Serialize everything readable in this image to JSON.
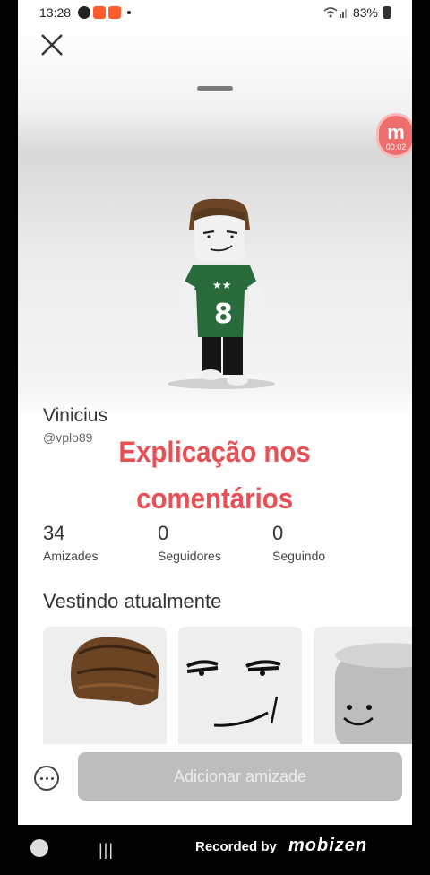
{
  "status_bar": {
    "time": "13:28",
    "battery": "83%"
  },
  "profile": {
    "display_name": "Vinicius",
    "handle": "@vplo89"
  },
  "overlay": {
    "line1": "Explicação nos",
    "line2": "comentários"
  },
  "stats": [
    {
      "value": "34",
      "label": "Amizades"
    },
    {
      "value": "0",
      "label": "Seguidores"
    },
    {
      "value": "0",
      "label": "Seguindo"
    }
  ],
  "wearing": {
    "title": "Vestindo atualmente"
  },
  "actions": {
    "add_friend": "Adicionar amizade"
  },
  "recording": {
    "timer": "00:02",
    "recorded_by": "Recorded by",
    "brand": "mobizen"
  },
  "colors": {
    "overlay_text": "#e94f55",
    "shirt": "#2a6b3c",
    "button_disabled": "#bdbdbd"
  },
  "icons": [
    "close-icon",
    "more-icon",
    "wifi-icon",
    "signal-icon",
    "battery-icon"
  ]
}
